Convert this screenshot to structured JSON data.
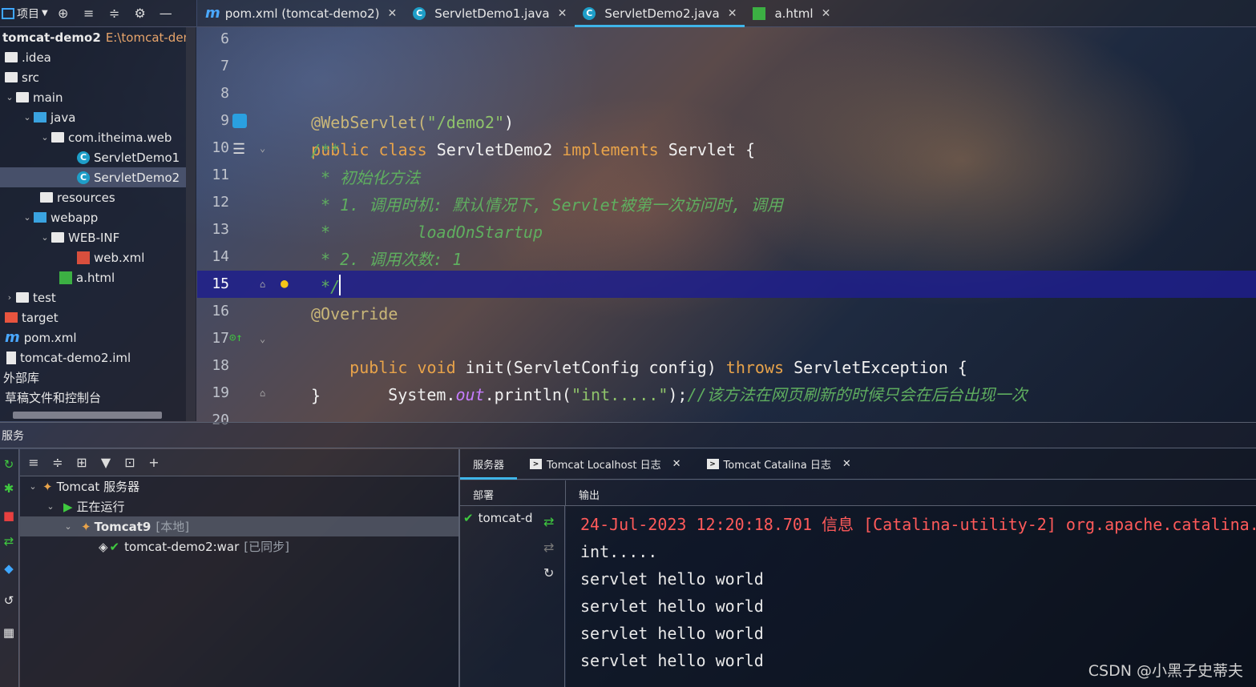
{
  "project": {
    "header_label": "项目",
    "root_name": "tomcat-demo2",
    "root_path": "E:\\tomcat-dem",
    "items": [
      {
        "label": ".idea",
        "depth": 0
      },
      {
        "label": "src",
        "depth": 0
      },
      {
        "label": "main",
        "depth": 0
      },
      {
        "label": "java",
        "depth": 1
      },
      {
        "label": "com.itheima.web",
        "depth": 2
      },
      {
        "label": "ServletDemo1",
        "depth": 3
      },
      {
        "label": "ServletDemo2",
        "depth": 3
      },
      {
        "label": "resources",
        "depth": 1
      },
      {
        "label": "webapp",
        "depth": 1
      },
      {
        "label": "WEB-INF",
        "depth": 2
      },
      {
        "label": "web.xml",
        "depth": 3
      },
      {
        "label": "a.html",
        "depth": 2
      },
      {
        "label": "test",
        "depth": 0
      },
      {
        "label": "target",
        "depth": 0
      },
      {
        "label": "pom.xml",
        "depth": 0
      },
      {
        "label": "tomcat-demo2.iml",
        "depth": 0
      },
      {
        "label": "外部库",
        "depth": 0
      },
      {
        "label": "草稿文件和控制台",
        "depth": 0
      }
    ]
  },
  "tabs": [
    {
      "label": "pom.xml (tomcat-demo2)",
      "kind": "maven",
      "active": false
    },
    {
      "label": "ServletDemo1.java",
      "kind": "class",
      "active": false
    },
    {
      "label": "ServletDemo2.java",
      "kind": "class",
      "active": true
    },
    {
      "label": "a.html",
      "kind": "html",
      "active": false
    }
  ],
  "editor": {
    "current_line": "15",
    "line_numbers": [
      "6",
      "7",
      "8",
      "9",
      "10",
      "11",
      "12",
      "13",
      "14",
      "15",
      "16",
      "17",
      "18",
      "19",
      "20"
    ],
    "lines": {
      "l8_ann": "@WebServlet(",
      "l8_str": "\"/demo2\"",
      "l8_end": ")",
      "l9_kw": "public class ",
      "l9_name": "ServletDemo2 ",
      "l9_impl": "implements ",
      "l9_rest": "Servlet {",
      "l10": "/**",
      "l11": " * 初始化方法",
      "l12": " * 1. 调用时机: 默认情况下, Servlet被第一次访问时, 调用",
      "l13": " *         loadOnStartup",
      "l14": " * 2. 调用次数: 1",
      "l15": " */",
      "l16": "@Override",
      "l17_kw": "public void ",
      "l17_name": "init(ServletConfig config) ",
      "l17_throws": "throws ",
      "l17_exc": "ServletException {",
      "l18_a": "System.",
      "l18_out": "out",
      "l18_b": ".println(",
      "l18_str": "\"int.....\"",
      "l18_c": ");",
      "l18_cmt": "//该方法在网页刷新的时候只会在后台出现一次",
      "l19": "}"
    }
  },
  "services": {
    "title": "服务",
    "tree": [
      {
        "label": "Tomcat 服务器",
        "extra": ""
      },
      {
        "label": "正在运行",
        "extra": ""
      },
      {
        "label": "Tomcat9",
        "extra": "[本地]"
      },
      {
        "label": "tomcat-demo2:war",
        "extra": "[已同步]"
      }
    ],
    "output_tabs": [
      {
        "label": "服务器",
        "active": true
      },
      {
        "label": "Tomcat Localhost 日志",
        "active": false
      },
      {
        "label": "Tomcat Catalina 日志",
        "active": false
      }
    ],
    "col_deploy": "部署",
    "col_output": "输出",
    "deploy_item": "tomcat-d",
    "output_lines": [
      "24-Jul-2023 12:20:18.701 信息 [Catalina-utility-2] org.apache.catalina.",
      "int.....",
      "servlet hello world",
      "servlet hello world",
      "servlet hello world",
      "servlet hello world"
    ]
  },
  "watermark": "CSDN @小黑子史蒂夫"
}
